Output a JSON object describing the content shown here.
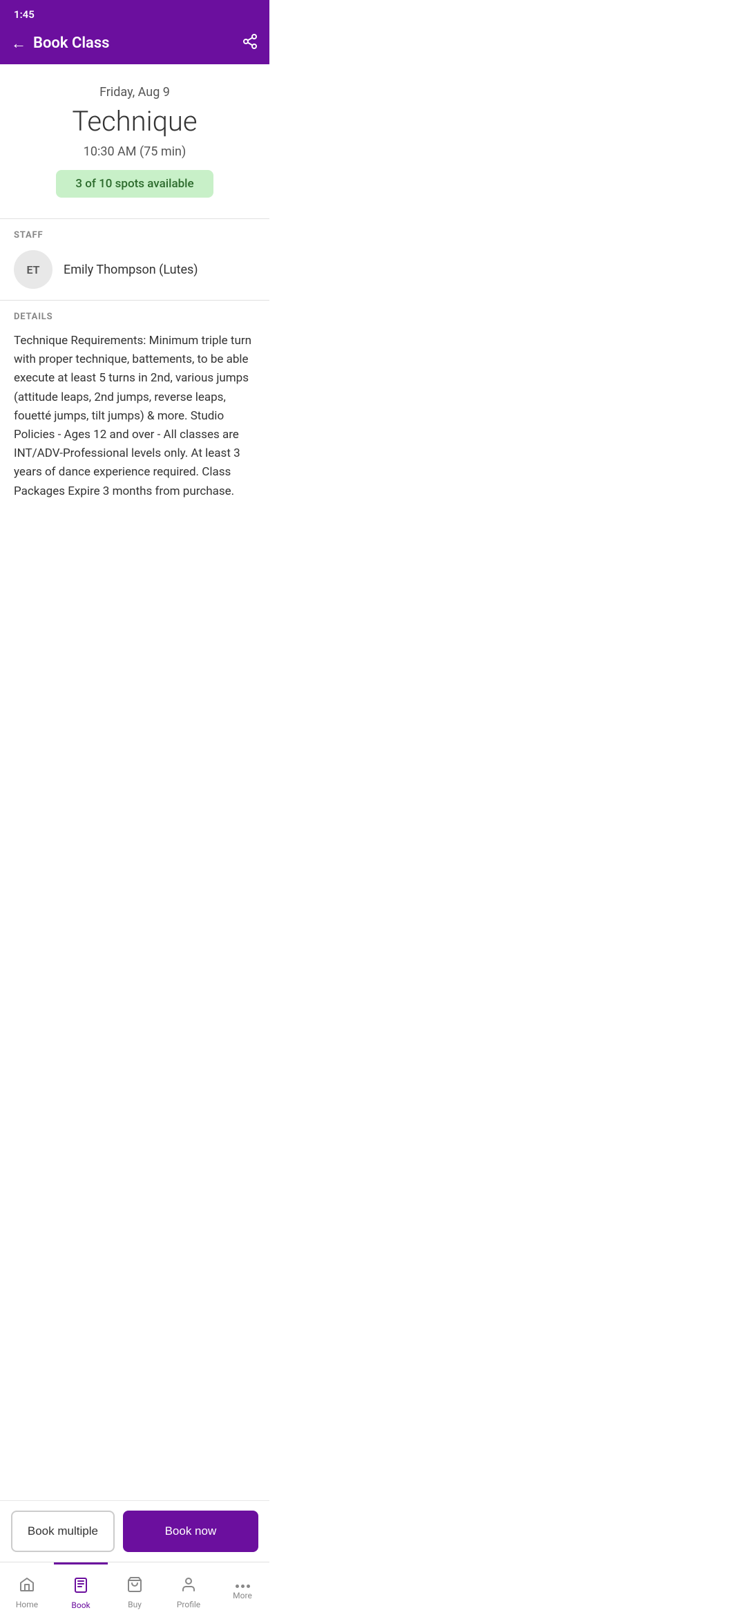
{
  "statusBar": {
    "time": "1:45"
  },
  "header": {
    "backLabel": "←",
    "title": "Book Class",
    "shareIcon": "share"
  },
  "classInfo": {
    "date": "Friday, Aug 9",
    "className": "Technique",
    "time": "10:30 AM (75 min)",
    "spotsAvailable": "3 of 10 spots available"
  },
  "staff": {
    "sectionLabel": "STAFF",
    "initials": "ET",
    "name": "Emily Thompson (Lutes)"
  },
  "details": {
    "sectionLabel": "DETAILS",
    "text": "Technique Requirements: Minimum triple turn with proper technique, battements, to be able execute at least 5 turns in 2nd, various jumps (attitude leaps, 2nd jumps, reverse leaps, fouetté jumps, tilt jumps) & more. Studio Policies - Ages 12 and over - All classes are INT/ADV-Professional levels only. At least 3 years of dance experience required. Class Packages Expire 3 months from purchase."
  },
  "buttons": {
    "bookMultiple": "Book multiple",
    "bookNow": "Book now"
  },
  "nav": {
    "items": [
      {
        "id": "home",
        "label": "Home",
        "icon": "home"
      },
      {
        "id": "book",
        "label": "Book",
        "icon": "book",
        "active": true
      },
      {
        "id": "buy",
        "label": "Buy",
        "icon": "buy"
      },
      {
        "id": "profile",
        "label": "Profile",
        "icon": "profile"
      },
      {
        "id": "more",
        "label": "More",
        "icon": "more"
      }
    ]
  }
}
